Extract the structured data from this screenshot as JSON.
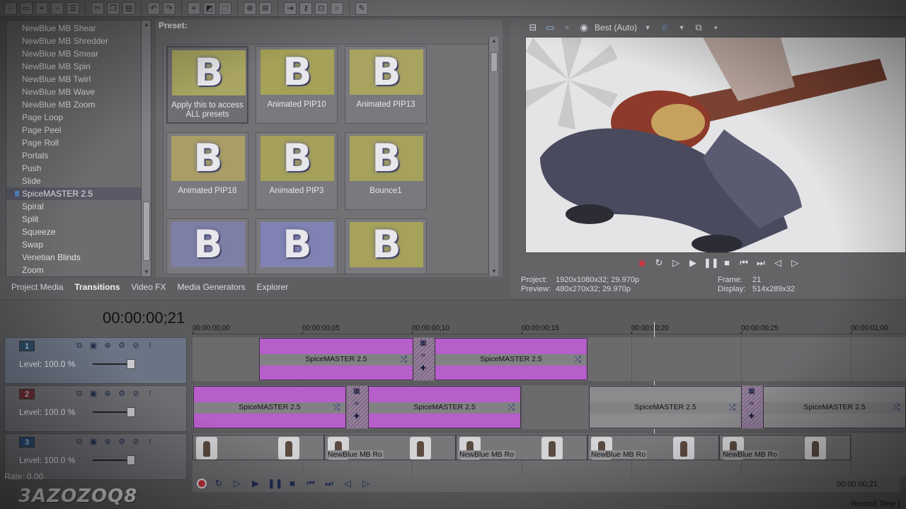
{
  "toolbar": {
    "buttons": [
      "new-icon",
      "open-icon",
      "save-icon",
      "save-as-icon",
      "properties-icon",
      "cut-icon",
      "copy-icon",
      "paste-icon",
      "undo-icon",
      "redo-icon",
      "normal-edit-icon",
      "envelope-icon",
      "selection-icon",
      "zoom-icon",
      "snap-icon",
      "auto-ripple-icon",
      "lock-envelopes-icon",
      "ignore-grouping-icon",
      "help-icon"
    ]
  },
  "transitions": {
    "items": [
      "NewBlue MB Shear",
      "NewBlue MB Shredder",
      "NewBlue MB Smear",
      "NewBlue MB Spin",
      "NewBlue MB Twirl",
      "NewBlue MB Wave",
      "NewBlue MB Zoom",
      "Page Loop",
      "Page Peel",
      "Page Roll",
      "Portals",
      "Push",
      "Slide",
      "SpiceMASTER 2.5",
      "Spiral",
      "Split",
      "Squeeze",
      "Swap",
      "Venetian Blinds",
      "Zoom"
    ],
    "selected": "SpiceMASTER 2.5"
  },
  "preset": {
    "label": "Preset:",
    "items": [
      {
        "name": "Apply this to access ALL presets",
        "letter": "B"
      },
      {
        "name": "Animated PIP10",
        "letter": "B"
      },
      {
        "name": "Animated PIP13",
        "letter": "B"
      },
      {
        "name": "Animated PIP18",
        "letter": "B"
      },
      {
        "name": "Animated PIP3",
        "letter": "B"
      },
      {
        "name": "Bounce1",
        "letter": "B"
      },
      {
        "name": "",
        "letter": "B"
      },
      {
        "name": "",
        "letter": "B"
      },
      {
        "name": "",
        "letter": "B"
      }
    ]
  },
  "preview": {
    "quality": "Best (Auto)",
    "project_label": "Project:",
    "project_value": "1920x1080x32; 29.970p",
    "preview_label": "Preview:",
    "preview_value": "480x270x32; 29.970p",
    "frame_label": "Frame:",
    "frame_value": "21",
    "display_label": "Display:",
    "display_value": "514x289x32"
  },
  "tabs": [
    {
      "label": "Project Media",
      "active": false
    },
    {
      "label": "Transitions",
      "active": true
    },
    {
      "label": "Video FX",
      "active": false
    },
    {
      "label": "Media Generators",
      "active": false
    },
    {
      "label": "Explorer",
      "active": false
    }
  ],
  "timeline": {
    "timecode": "00:00:00;21",
    "ruler": [
      "00:00:00;00",
      "00:00:00;05",
      "00:00:00;10",
      "00:00:00;15",
      "00:00:00;20",
      "00:00:00;25",
      "00:00:01;00"
    ],
    "tracks": [
      {
        "number": "1",
        "level": "Level: 100.0 %"
      },
      {
        "number": "2",
        "level": "Level: 100.0 %"
      },
      {
        "number": "3",
        "level": "Level: 100.0 %"
      }
    ],
    "clip_name": "SpiceMASTER 2.5",
    "video_clip_name": "NewBlue MB Ro",
    "rate": "Rate: 0.00",
    "end_time": "00:00:00;21",
    "record_time": "Record Time (",
    "watermark": "3AZOZOQ8"
  }
}
